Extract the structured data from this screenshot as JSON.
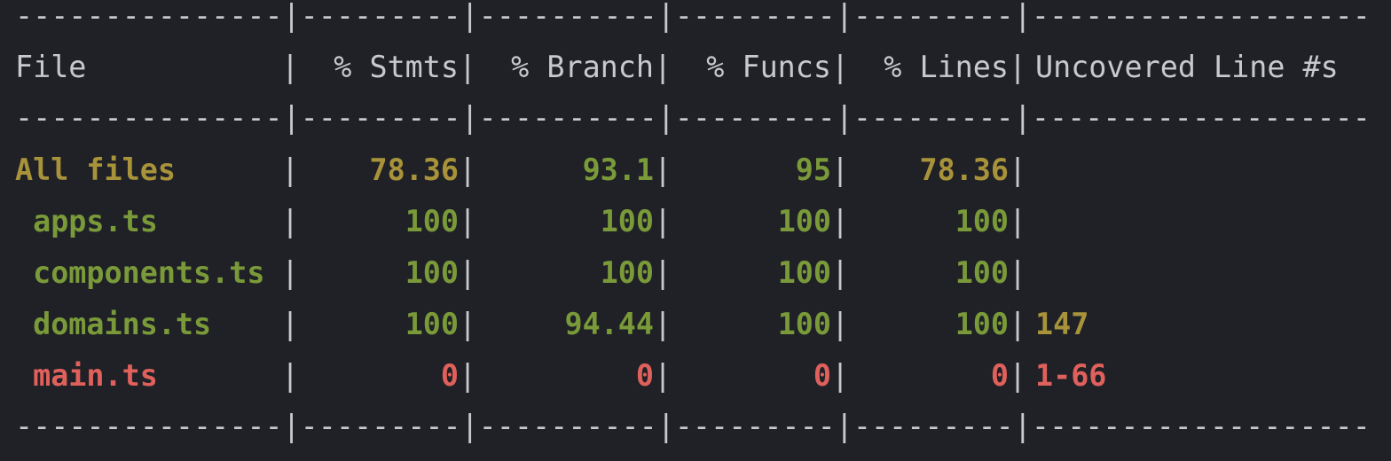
{
  "rule": "---------------|---------|----------|---------|---------|-------------------",
  "header": {
    "file": "File",
    "stmts": "% Stmts",
    "branch": "% Branch",
    "funcs": "% Funcs",
    "lines": "% Lines",
    "uncovered": "Uncovered Line #s"
  },
  "rows": [
    {
      "file": "All files",
      "stmts": "78.36",
      "branch": "93.1",
      "funcs": "95",
      "lines": "78.36",
      "uncovered": ""
    },
    {
      "file": " apps.ts",
      "stmts": "100",
      "branch": "100",
      "funcs": "100",
      "lines": "100",
      "uncovered": ""
    },
    {
      "file": " components.ts",
      "stmts": "100",
      "branch": "100",
      "funcs": "100",
      "lines": "100",
      "uncovered": ""
    },
    {
      "file": " domains.ts",
      "stmts": "100",
      "branch": "94.44",
      "funcs": "100",
      "lines": "100",
      "uncovered": "147"
    },
    {
      "file": " main.ts",
      "stmts": "0",
      "branch": "0",
      "funcs": "0",
      "lines": "0",
      "uncovered": "1-66"
    }
  ],
  "colors": {
    "background": "#1f2126",
    "text": "#c7c9ce",
    "yellow": "#a8933a",
    "green": "#7a9a3a",
    "red": "#e0605c"
  }
}
